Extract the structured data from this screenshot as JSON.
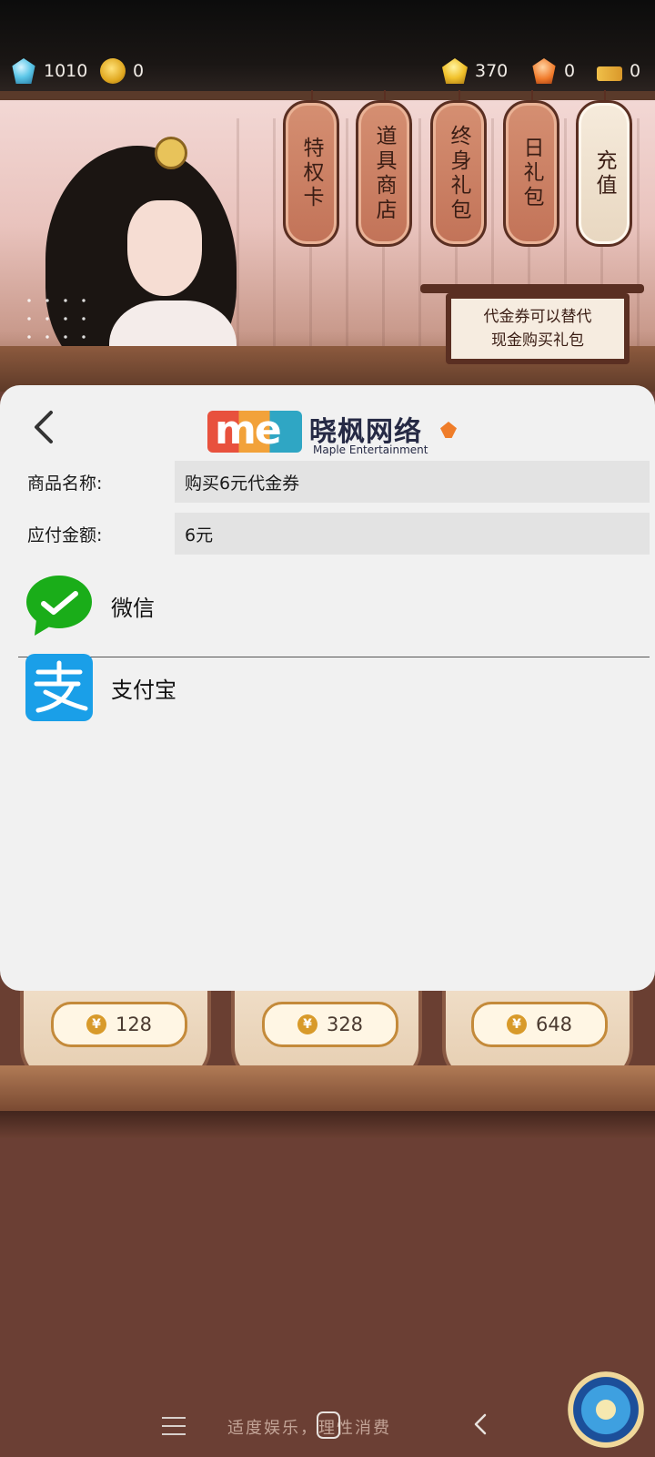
{
  "resources": {
    "left": [
      {
        "icon": "blue-gem-icon",
        "value": "1010"
      },
      {
        "icon": "thumbs-up-coin-icon",
        "value": "0"
      }
    ],
    "right": [
      {
        "icon": "gold-ingot-icon",
        "value": "370"
      },
      {
        "icon": "orange-gem-icon",
        "value": "0"
      },
      {
        "icon": "ticket-icon",
        "value": "0"
      }
    ]
  },
  "shop_tabs": [
    {
      "label": "特权卡"
    },
    {
      "label": "道具商店"
    },
    {
      "label": "终身礼包"
    },
    {
      "label": "日礼包"
    },
    {
      "label": "充值"
    }
  ],
  "notice_board": {
    "line1": "代金券可以替代",
    "line2": "现金购买礼包"
  },
  "payment": {
    "brand_cn": "晓枫网络",
    "brand_en": "Maple Entertainment",
    "brand_logo_text": "me",
    "product_label": "商品名称:",
    "product_value": "购买6元代金券",
    "amount_label": "应付金额:",
    "amount_value": "6元",
    "methods": [
      {
        "label": "微信",
        "icon": "wechat-icon",
        "color": "#1aad19"
      },
      {
        "label": "支付宝",
        "icon": "alipay-icon",
        "color": "#1a9fe8"
      }
    ]
  },
  "price_cards": [
    {
      "symbol": "¥",
      "price": "128"
    },
    {
      "symbol": "¥",
      "price": "328"
    },
    {
      "symbol": "¥",
      "price": "648"
    }
  ],
  "footer": {
    "slogan": "适度娱乐，理性消费"
  },
  "colors": {
    "sheet_bg": "#f1f1f1",
    "field_bg": "#e3e3e3",
    "wood": "#6a3f32"
  }
}
